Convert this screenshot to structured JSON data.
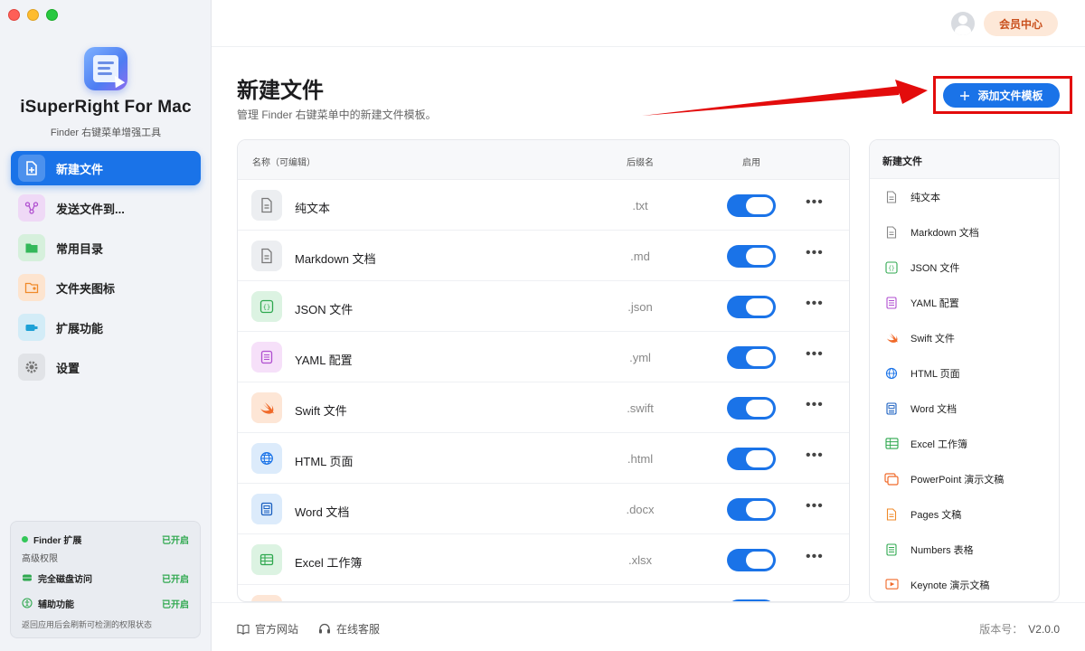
{
  "app": {
    "name": "iSuperRight For Mac",
    "subtitle": "Finder 右键菜单增强工具"
  },
  "sidebar": {
    "items": [
      {
        "label": "新建文件",
        "icon": "new-file-icon",
        "active": true
      },
      {
        "label": "发送文件到...",
        "icon": "send-icon",
        "active": false
      },
      {
        "label": "常用目录",
        "icon": "folder-icon",
        "active": false
      },
      {
        "label": "文件夹图标",
        "icon": "folder-image-icon",
        "active": false
      },
      {
        "label": "扩展功能",
        "icon": "extension-icon",
        "active": false
      },
      {
        "label": "设置",
        "icon": "gear-icon",
        "active": false
      }
    ],
    "permissions": {
      "finder_ext": {
        "label": "Finder 扩展",
        "status": "已开启"
      },
      "section": "高级权限",
      "disk": {
        "label": "完全磁盘访问",
        "status": "已开启"
      },
      "accessibility": {
        "label": "辅助功能",
        "status": "已开启"
      },
      "footer": "返回应用后会刷新可检测的权限状态"
    }
  },
  "topbar": {
    "member_label": "会员中心"
  },
  "page": {
    "title": "新建文件",
    "description": "管理 Finder 右键菜单中的新建文件模板。",
    "add_button": "添加文件模板"
  },
  "table": {
    "headers": {
      "name": "名称（可编辑）",
      "ext": "后缀名",
      "enabled": "启用"
    },
    "rows": [
      {
        "name": "纯文本",
        "ext": ".txt",
        "enabled": true
      },
      {
        "name": "Markdown 文档",
        "ext": ".md",
        "enabled": true
      },
      {
        "name": "JSON 文件",
        "ext": ".json",
        "enabled": true
      },
      {
        "name": "YAML 配置",
        "ext": ".yml",
        "enabled": true
      },
      {
        "name": "Swift 文件",
        "ext": ".swift",
        "enabled": true
      },
      {
        "name": "HTML 页面",
        "ext": ".html",
        "enabled": true
      },
      {
        "name": "Word 文档",
        "ext": ".docx",
        "enabled": true
      },
      {
        "name": "Excel 工作簿",
        "ext": ".xlsx",
        "enabled": true
      }
    ]
  },
  "preview": {
    "title": "新建文件",
    "items": [
      "纯文本",
      "Markdown 文档",
      "JSON 文件",
      "YAML 配置",
      "Swift 文件",
      "HTML 页面",
      "Word 文档",
      "Excel 工作簿",
      "PowerPoint 演示文稿",
      "Pages 文稿",
      "Numbers 表格",
      "Keynote 演示文稿"
    ]
  },
  "footer": {
    "website": "官方网站",
    "support": "在线客服",
    "version_label": "版本号：",
    "version": "V2.0.0"
  },
  "colors": {
    "accent": "#1a73e8",
    "member_bg": "#fde8d8",
    "member_text": "#c9501d",
    "highlight": "#e30c0c",
    "status_on": "#2fa84f"
  }
}
